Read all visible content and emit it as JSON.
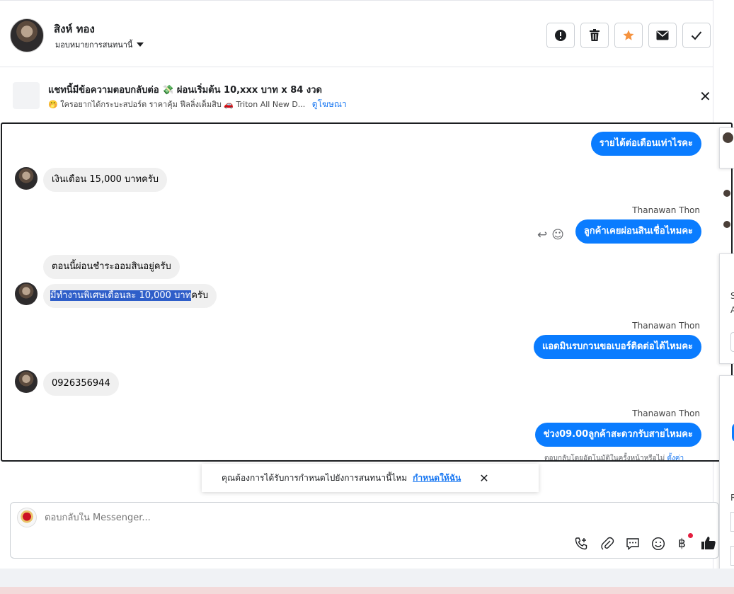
{
  "header": {
    "contact_name": "สิงห์ ทอง",
    "assign_label": "มอบหมายการสนทนานี้",
    "actions": [
      {
        "icon": "alert-icon",
        "glyph": "!"
      },
      {
        "icon": "trash-icon",
        "glyph": "🗑"
      },
      {
        "icon": "star-icon",
        "glyph": "★"
      },
      {
        "icon": "mail-icon",
        "glyph": "✉"
      },
      {
        "icon": "check-icon",
        "glyph": "✓"
      }
    ]
  },
  "ad": {
    "title": "แชทนี้มีข้อความตอบกลับต่อ 💸 ผ่อนเริ่มต้น 10,xxx บาท x 84 งวด",
    "subtitle": "🤭 ใครอยากได้กระบะสปอร์ต ราคาคุ้ม ฟีลลิ่งเต็มสิบ 🚗 Triton All New D...",
    "link": "ดูโฆษณา",
    "close_glyph": "✕"
  },
  "messages": {
    "out1": "รายได้ต่อเดือนเท่าไรคะ",
    "in1": "เงินเดือน 15,000 บาทครับ",
    "sender2": "Thanawan Thon",
    "out2": "ลูกค้าเคยผ่อนสินเชื่อไหมคะ",
    "in2": "ตอนนี้ผ่อนชำระออมสินอยู่ครับ",
    "in3_highlight": "มีทำงานพิเศษเดือนละ 10,000 บาท",
    "in3_rest": "ครับ",
    "sender3": "Thanawan Thon",
    "out3": "แอดมินรบกวนขอเบอร์ติดต่อได้ไหมคะ",
    "in4": "0926356944",
    "sender4": "Thanawan Thon",
    "out4": "ช่วง09.00ลูกค้าสะดวกรับสายไหมคะ",
    "autoreply_text": "ตอบกลับโดยอัตโนมัติในครั้งหน้าหรือไม่",
    "autoreply_link": "ตั้งค่า"
  },
  "toast": {
    "text": "คุณต้องการได้รับการกำหนดไปยังการสนทนานี้ไหม",
    "link": "กำหนดให้ฉัน",
    "close_glyph": "✕"
  },
  "composer": {
    "placeholder": "ตอบกลับใน Messenger..."
  },
  "side": {
    "letters": [
      "S",
      "A",
      "R"
    ]
  },
  "colors": {
    "accent": "#0a7cff",
    "link": "#1877f2",
    "star": "#f5923e"
  }
}
